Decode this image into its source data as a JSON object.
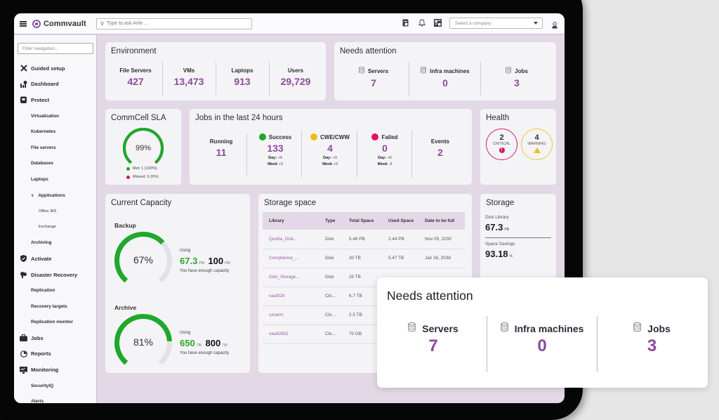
{
  "app": {
    "brand": "Commvault",
    "search_placeholder": "Type to ask Arlie ...",
    "company_select_placeholder": "Select a company",
    "top_icons": [
      "calendar-icon",
      "bell-icon",
      "grid-icon",
      "user-icon"
    ]
  },
  "sidebar": {
    "filter_placeholder": "Filter navigation...",
    "items": [
      {
        "label": "Guided setup",
        "level": "top",
        "icon": "tools-icon"
      },
      {
        "label": "Dashboard",
        "level": "top",
        "icon": "dashboard-icon"
      },
      {
        "label": "Protect",
        "level": "top",
        "icon": "shield-icon"
      },
      {
        "label": "Virtualization",
        "level": "sub"
      },
      {
        "label": "Kubernetes",
        "level": "sub"
      },
      {
        "label": "File servers",
        "level": "sub"
      },
      {
        "label": "Databases",
        "level": "sub"
      },
      {
        "label": "Laptops",
        "level": "sub"
      },
      {
        "label": "Applications",
        "level": "subexp"
      },
      {
        "label": "Office 365",
        "level": "sub2"
      },
      {
        "label": "Exchange",
        "level": "sub2"
      },
      {
        "label": "Archiving",
        "level": "sub"
      },
      {
        "label": "Activate",
        "level": "top",
        "icon": "shield-check-icon"
      },
      {
        "label": "Disaster Recovery",
        "level": "top",
        "icon": "cloud-recovery-icon"
      },
      {
        "label": "Replication",
        "level": "sub"
      },
      {
        "label": "Recovery targets",
        "level": "sub"
      },
      {
        "label": "Replication monitor",
        "level": "sub"
      },
      {
        "label": "Jobs",
        "level": "top",
        "icon": "briefcase-icon"
      },
      {
        "label": "Reports",
        "level": "top",
        "icon": "reports-icon"
      },
      {
        "label": "Monitoring",
        "level": "top",
        "icon": "monitor-icon"
      },
      {
        "label": "SecurityIQ",
        "level": "sub"
      },
      {
        "label": "Alerts",
        "level": "sub"
      }
    ]
  },
  "environment": {
    "title": "Environment",
    "metrics": [
      {
        "label": "File Servers",
        "value": "427"
      },
      {
        "label": "VMs",
        "value": "13,473"
      },
      {
        "label": "Laptops",
        "value": "913"
      },
      {
        "label": "Users",
        "value": "29,729"
      }
    ]
  },
  "needs_attention": {
    "title": "Needs attention",
    "metrics": [
      {
        "label": "Servers",
        "value": "7"
      },
      {
        "label": "Infra machines",
        "value": "0"
      },
      {
        "label": "Jobs",
        "value": "3"
      }
    ]
  },
  "sla": {
    "title": "CommCell SLA",
    "percent_label": "99%",
    "met_fraction": 0.99,
    "met_label": "Met: 1 (100%)",
    "missed_label": "Missed: 0 (0%)",
    "met_color": "#1fa82a",
    "missed_color": "#e0115f"
  },
  "jobs24": {
    "title": "Jobs in the last 24 hours",
    "running": {
      "label": "Running",
      "value": "11"
    },
    "success": {
      "label": "Success",
      "value": "133",
      "day_label": "Day:",
      "day": "+4",
      "week_label": "Week",
      "week": "+2",
      "color": "#1fa82a"
    },
    "cwe": {
      "label": "CWE/CWW",
      "value": "4",
      "day_label": "Day:",
      "day": "+3",
      "week_label": "Week",
      "week": "+3",
      "color": "#e9bf1a"
    },
    "failed": {
      "label": "Failed",
      "value": "0",
      "day_label": "Day:",
      "day": "+0",
      "week_label": "Week",
      "week": "-3",
      "color": "#e8115e"
    },
    "events": {
      "label": "Events",
      "value": "2"
    }
  },
  "health": {
    "title": "Health",
    "critical": {
      "count": "2",
      "label": "CRITICAL",
      "color": "#e0245e"
    },
    "warning": {
      "count": "4",
      "label": "WARNING",
      "color": "#e3cc3a"
    }
  },
  "capacity": {
    "title": "Current Capacity",
    "using_label": "Using",
    "enough_label": "You have enough capacity",
    "backup": {
      "label": "Backup",
      "percent_label": "67%",
      "fraction": 0.67,
      "used": "67.3",
      "used_unit": "PB/",
      "total": "100",
      "total_unit": "PB/"
    },
    "archive": {
      "label": "Archive",
      "percent_label": "81%",
      "fraction": 0.81,
      "used": "650",
      "used_unit": "TB/",
      "total": "800",
      "total_unit": "TB/"
    }
  },
  "storage_space": {
    "title": "Storage space",
    "columns": [
      "Library",
      "Type",
      "Total Space",
      "Used Space",
      "Date to be full"
    ],
    "rows": [
      [
        "Quotta_Disk...",
        "Disk",
        "5.46 PB",
        "2.44 PB",
        "Nov 05, 2030"
      ],
      [
        "Compliance_...",
        "Disk",
        "30 TB",
        "5.47 TB",
        "Jan 26, 2038"
      ],
      [
        "Disk_Storage...",
        "Disk",
        "25 TB",
        "",
        ""
      ],
      [
        "vaultf28",
        "Clo...",
        "6.7 TB",
        "",
        ""
      ],
      [
        "szvarm",
        "Clo...",
        "2.5 TB",
        "",
        ""
      ],
      [
        "vault2802",
        "Clo...",
        "70 GB",
        "",
        ""
      ]
    ]
  },
  "storage": {
    "title": "Storage",
    "disk_library_label": "Disk Library",
    "disk_library_value": "67.3",
    "disk_library_unit": "PB",
    "savings_label": "Space Savings",
    "savings_value": "93.18",
    "savings_unit": "%"
  },
  "popup": {
    "title": "Needs attention",
    "metrics": [
      {
        "label": "Servers",
        "value": "7"
      },
      {
        "label": "Infra machines",
        "value": "0"
      },
      {
        "label": "Jobs",
        "value": "3"
      }
    ]
  },
  "colors": {
    "accent": "#8b4a9c",
    "gauge_green": "#1fa82a",
    "gauge_track": "#e2e2e6",
    "page_bg": "#e3d8e6"
  }
}
